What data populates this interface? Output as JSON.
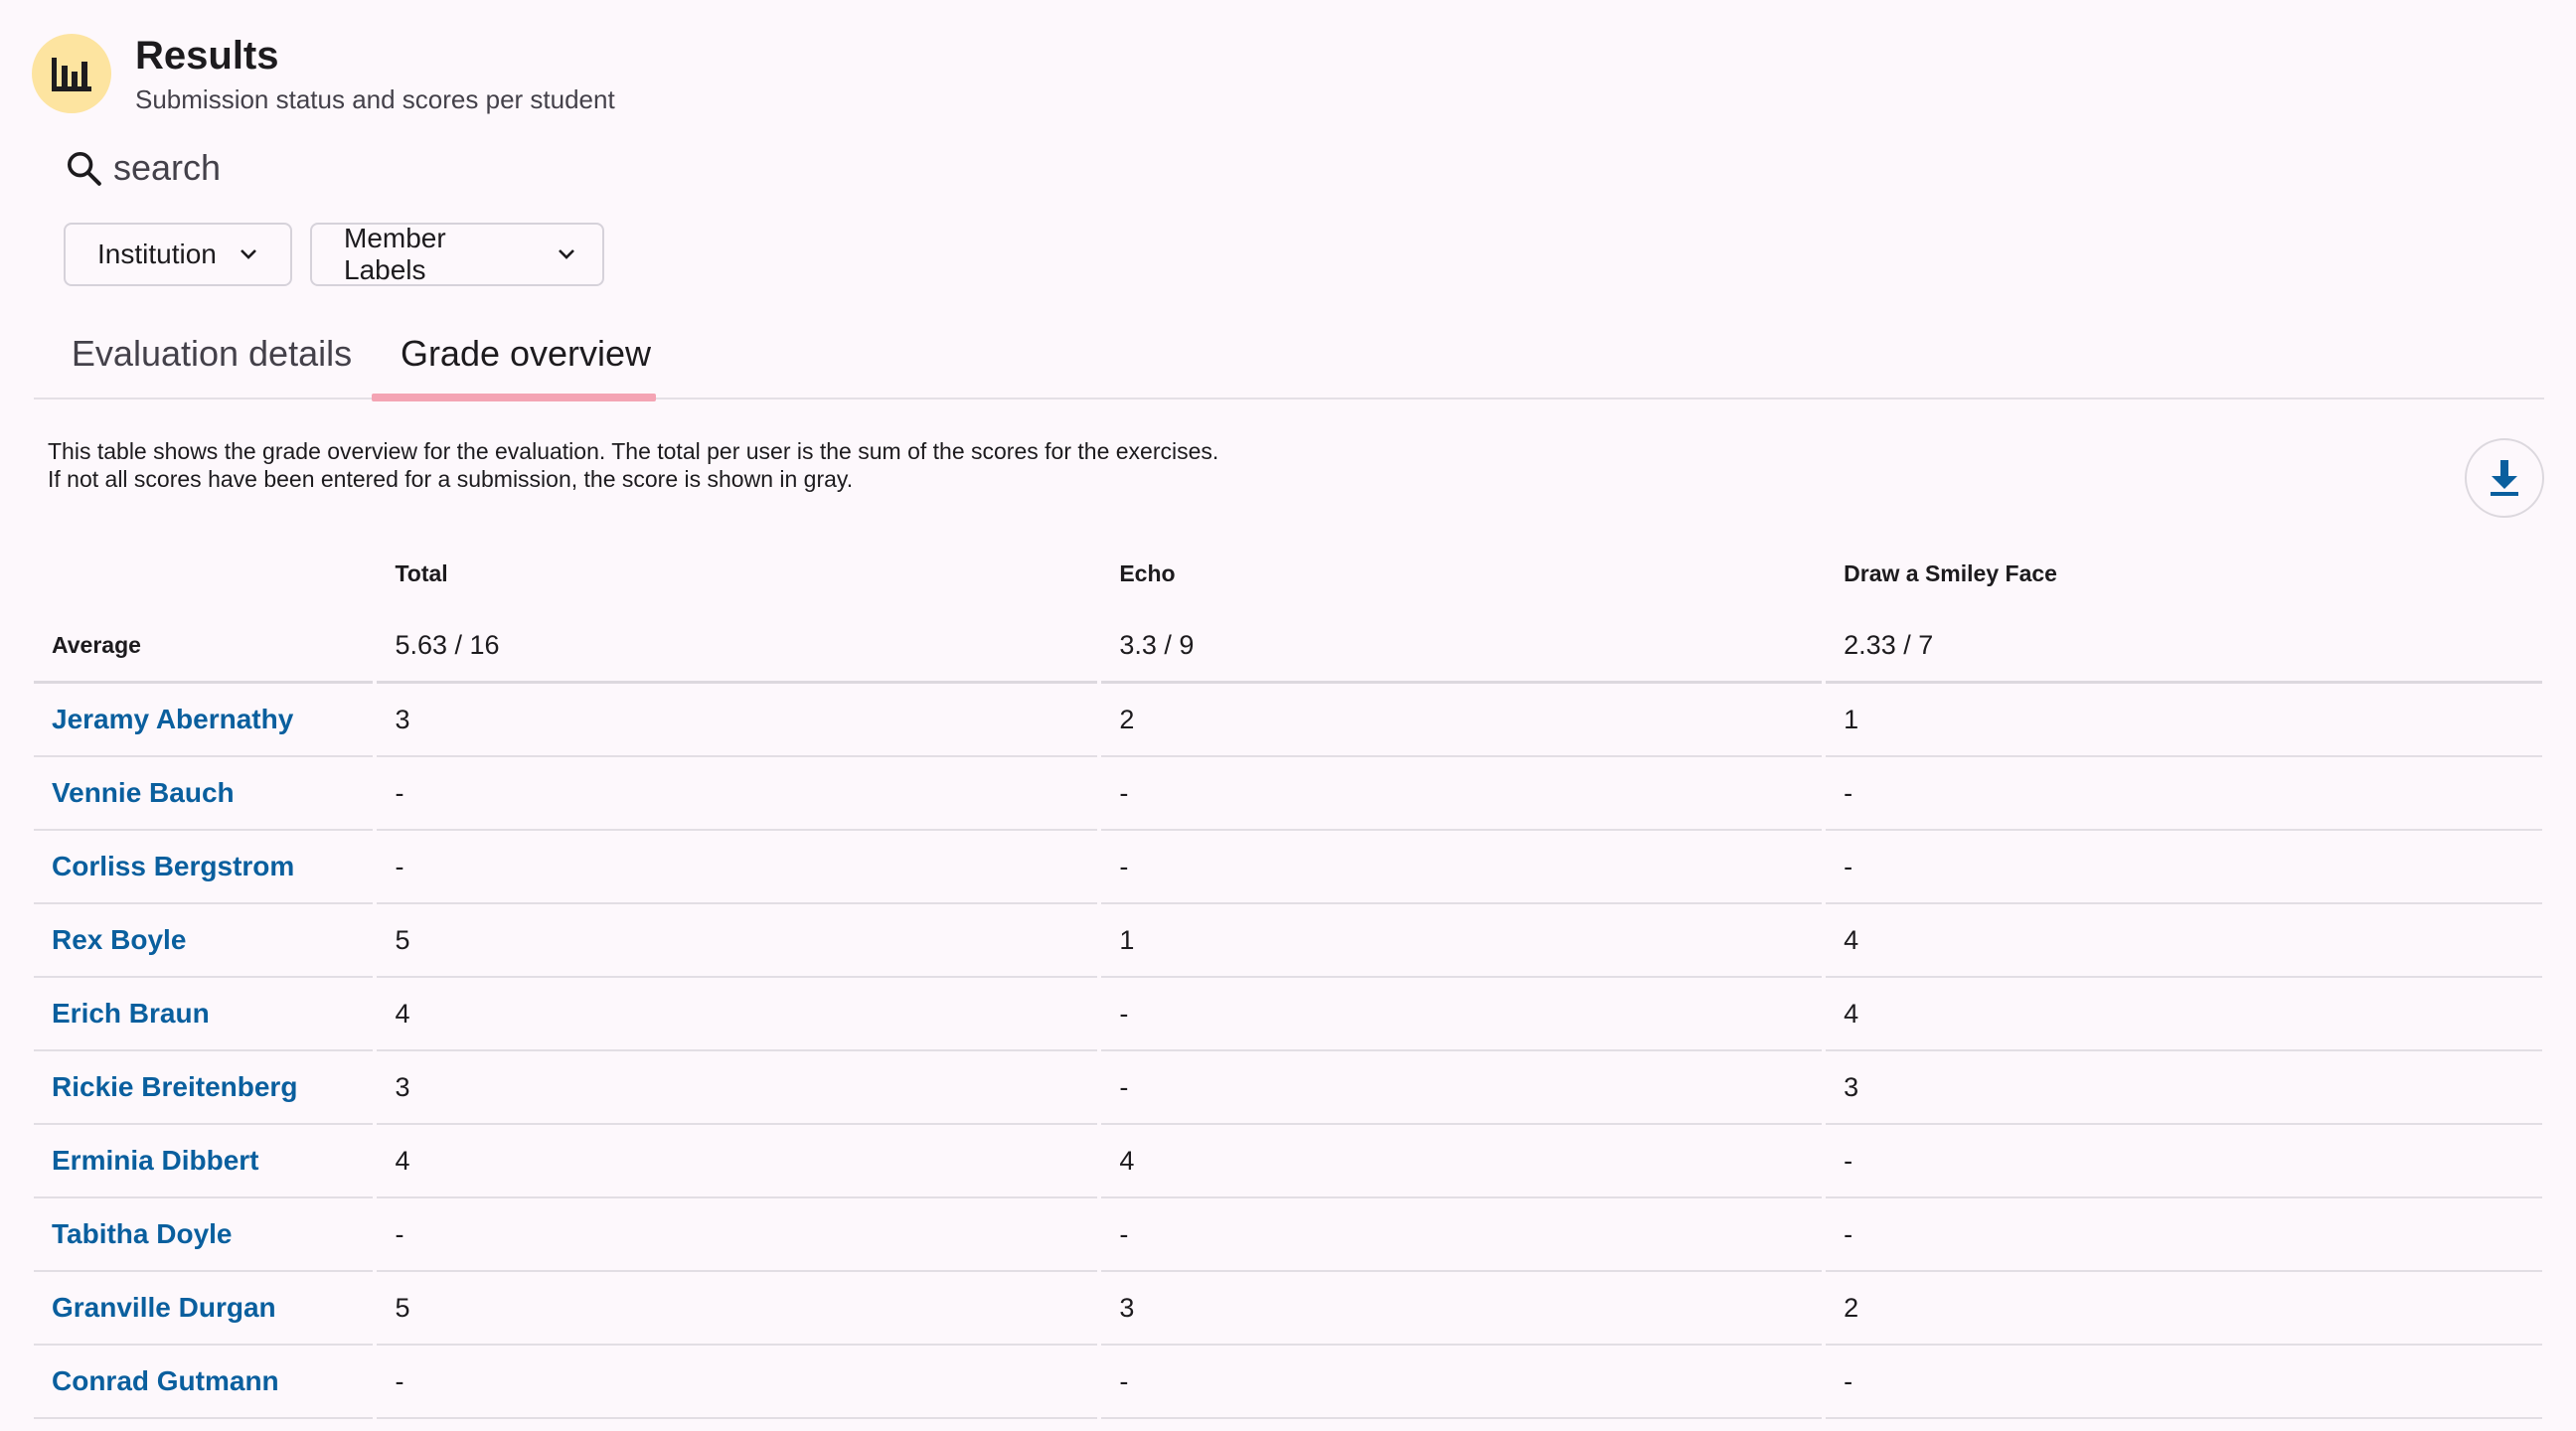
{
  "header": {
    "title": "Results",
    "subtitle": "Submission status and scores per student",
    "icon": "bar-chart-icon",
    "icon_bg": "#fde4a0"
  },
  "search": {
    "placeholder": "search",
    "value": ""
  },
  "filters": [
    {
      "label": "Institution"
    },
    {
      "label": "Member Labels"
    }
  ],
  "tabs": [
    {
      "label": "Evaluation details",
      "active": false
    },
    {
      "label": "Grade overview",
      "active": true
    }
  ],
  "description": {
    "line1": "This table shows the grade overview for the evaluation. The total per user is the sum of the scores for the exercises.",
    "line2": "If not all scores have been entered for a submission, the score is shown in gray."
  },
  "download_icon": "download-icon",
  "colors": {
    "accent": "#0a5f9e",
    "tab_indicator": "#f4a4b4",
    "background": "#fdf8fc"
  },
  "table": {
    "columns": [
      "",
      "Total",
      "Echo",
      "Draw a Smiley Face"
    ],
    "average": {
      "label": "Average",
      "total": "5.63 / 16",
      "echo": "3.3 / 9",
      "smiley": "2.33 / 7"
    },
    "rows": [
      {
        "name": "Jeramy Abernathy",
        "total": "3",
        "echo": "2",
        "smiley": "1"
      },
      {
        "name": "Vennie Bauch",
        "total": "-",
        "echo": "-",
        "smiley": "-"
      },
      {
        "name": "Corliss Bergstrom",
        "total": "-",
        "echo": "-",
        "smiley": "-"
      },
      {
        "name": "Rex Boyle",
        "total": "5",
        "echo": "1",
        "smiley": "4"
      },
      {
        "name": "Erich Braun",
        "total": "4",
        "echo": "-",
        "smiley": "4"
      },
      {
        "name": "Rickie Breitenberg",
        "total": "3",
        "echo": "-",
        "smiley": "3"
      },
      {
        "name": "Erminia Dibbert",
        "total": "4",
        "echo": "4",
        "smiley": "-"
      },
      {
        "name": "Tabitha Doyle",
        "total": "-",
        "echo": "-",
        "smiley": "-"
      },
      {
        "name": "Granville Durgan",
        "total": "5",
        "echo": "3",
        "smiley": "2"
      },
      {
        "name": "Conrad Gutmann",
        "total": "-",
        "echo": "-",
        "smiley": "-"
      }
    ]
  }
}
